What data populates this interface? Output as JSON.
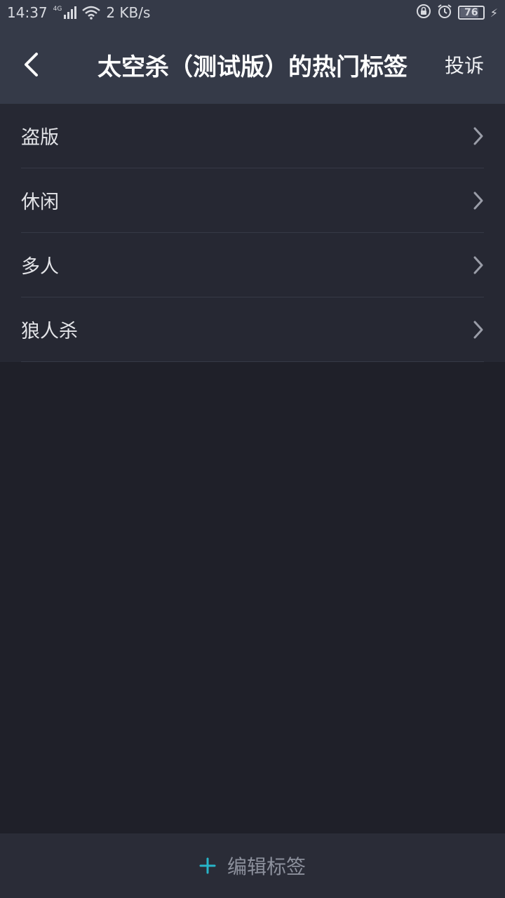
{
  "status_bar": {
    "time": "14:37",
    "network_type": "4G",
    "speed": "2 KB/s",
    "battery": "76",
    "battery_level": 0.76
  },
  "header": {
    "title": "太空杀（测试版）的热门标签",
    "report_label": "投诉"
  },
  "tags": [
    {
      "label": "盗版"
    },
    {
      "label": "休闲"
    },
    {
      "label": "多人"
    },
    {
      "label": "狼人杀"
    }
  ],
  "bottom_bar": {
    "edit_label": "编辑标签",
    "accent_color": "#27b5c8"
  },
  "colors": {
    "header_bg": "#353a48",
    "list_bg": "#262833",
    "page_bg": "#1f2029"
  }
}
